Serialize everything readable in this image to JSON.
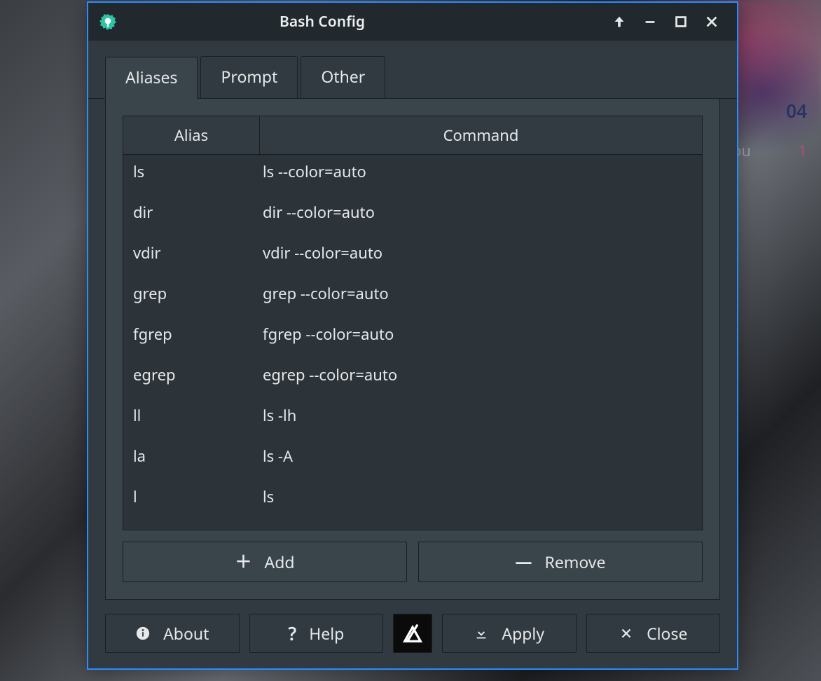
{
  "window": {
    "title": "Bash Config"
  },
  "tabs": [
    {
      "label": "Aliases",
      "active": true
    },
    {
      "label": "Prompt",
      "active": false
    },
    {
      "label": "Other",
      "active": false
    }
  ],
  "table": {
    "headers": {
      "alias": "Alias",
      "command": "Command"
    },
    "rows": [
      {
        "alias": "ls",
        "command": "ls --color=auto"
      },
      {
        "alias": "dir",
        "command": "dir --color=auto"
      },
      {
        "alias": "vdir",
        "command": "vdir --color=auto"
      },
      {
        "alias": "grep",
        "command": "grep --color=auto"
      },
      {
        "alias": "fgrep",
        "command": "fgrep --color=auto"
      },
      {
        "alias": "egrep",
        "command": "egrep --color=auto"
      },
      {
        "alias": "ll",
        "command": "ls -lh"
      },
      {
        "alias": "la",
        "command": "ls -A"
      },
      {
        "alias": "l",
        "command": "ls"
      }
    ]
  },
  "buttons": {
    "add": "Add",
    "remove": "Remove",
    "about": "About",
    "help": "Help",
    "apply": "Apply",
    "close": "Close"
  },
  "desktop_hints": {
    "t1": "04",
    "t2": "ou",
    "t3": "1"
  }
}
